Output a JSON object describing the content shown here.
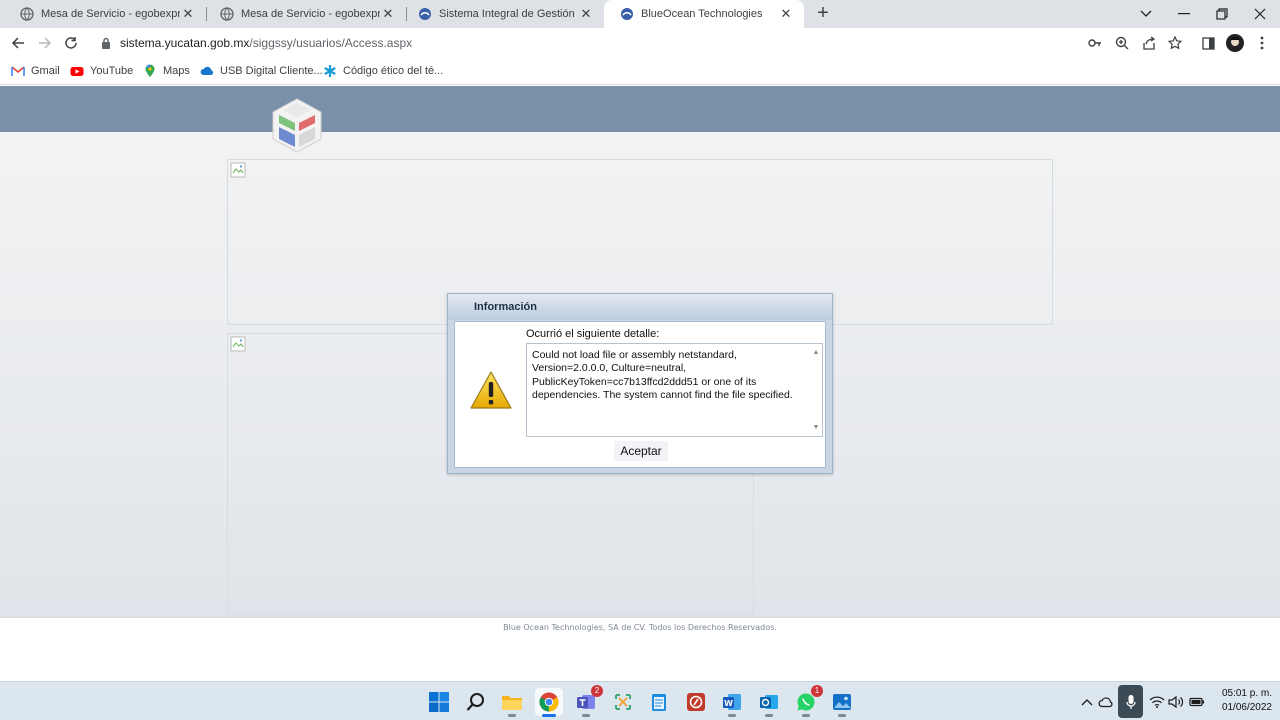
{
  "browser": {
    "tabs": [
      {
        "title": "Mesa de Servicio - egobexpress",
        "icon": "globe-icon"
      },
      {
        "title": "Mesa de Servicio - egobexpress",
        "icon": "globe-icon"
      },
      {
        "title": "Sistema Integral de Gestión Gube",
        "icon": "blueocean-icon"
      },
      {
        "title": "BlueOcean Technologies",
        "icon": "blueocean-icon",
        "active": true
      }
    ],
    "url_host": "sistema.yucatan.gob.mx",
    "url_path": "/siggssy/usuarios/Access.aspx",
    "bookmarks": [
      {
        "label": "Gmail",
        "icon": "gmail-icon"
      },
      {
        "label": "YouTube",
        "icon": "youtube-icon"
      },
      {
        "label": "Maps",
        "icon": "maps-icon"
      },
      {
        "label": "USB Digital Cliente...",
        "icon": "cloud-icon"
      },
      {
        "label": "Código ético del té...",
        "icon": "asterisk-icon"
      }
    ]
  },
  "page": {
    "footer": "Blue Ocean Technologies, SA de CV. Todos los Derechos Reservados."
  },
  "dialog": {
    "title": "Información",
    "detail_label": "Ocurrió el siguiente detalle:",
    "detail_text": "Could not load file or assembly netstandard, Version=2.0.0.0, Culture=neutral, PublicKeyToken=cc7b13ffcd2ddd51 or one of its dependencies. The system cannot find the file specified.",
    "ok_label": "Aceptar"
  },
  "taskbar": {
    "teams_badge": "2",
    "whatsapp_badge": "1",
    "time": "05:01 p. m.",
    "date": "01/06/2022"
  },
  "colors": {
    "header": "#7a90a8",
    "dialog_title": "#bccbdd"
  }
}
